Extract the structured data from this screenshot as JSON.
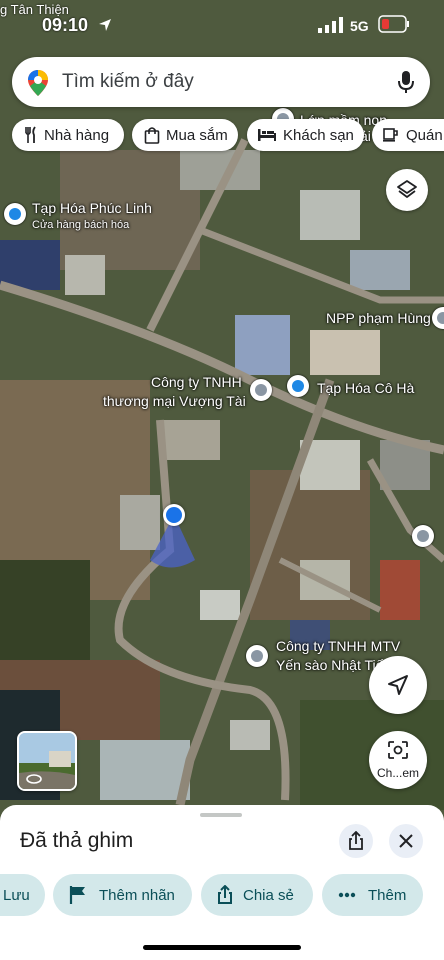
{
  "status_bar": {
    "corner_text": "g Tân Thiện",
    "time": "09:10",
    "network": "5G"
  },
  "search": {
    "placeholder": "Tìm kiếm ở đây"
  },
  "chips": [
    {
      "label": "Nhà hàng",
      "icon": "fork-knife-icon"
    },
    {
      "label": "Mua sắm",
      "icon": "shopping-bag-icon"
    },
    {
      "label": "Khách sạn",
      "icon": "bed-icon"
    },
    {
      "label": "Quán",
      "icon": "coffee-icon"
    }
  ],
  "map_labels": {
    "top_poi": "Lớp mầm non",
    "top_poi_tail": "ải",
    "shop1_name": "Tạp Hóa Phúc Linh",
    "shop1_sub": "Cửa hàng bách hóa",
    "npp": "NPP phạm Hùng",
    "company1_line1": "Công ty TNHH",
    "company1_line2": "thương mại Vượng Tài",
    "shop2_name": "Tạp Hóa Cô Hà",
    "company2_line1": "Công ty TNHH MTV",
    "company2_line2": "Yến sào Nhật Tiến"
  },
  "lens_label": "Ch...em",
  "sheet": {
    "title": "Đã thả ghim",
    "actions": [
      {
        "label": "Lưu",
        "icon": "bookmark-icon"
      },
      {
        "label": "Thêm nhãn",
        "icon": "flag-icon"
      },
      {
        "label": "Chia sẻ",
        "icon": "share-icon"
      },
      {
        "label": "Thêm",
        "icon": "more-icon"
      }
    ]
  },
  "colors": {
    "accent": "#1a73e8",
    "action_bg": "#d3e8ea",
    "poi_grey": "#8a96a3",
    "shop_blue": "#1e88e5"
  }
}
